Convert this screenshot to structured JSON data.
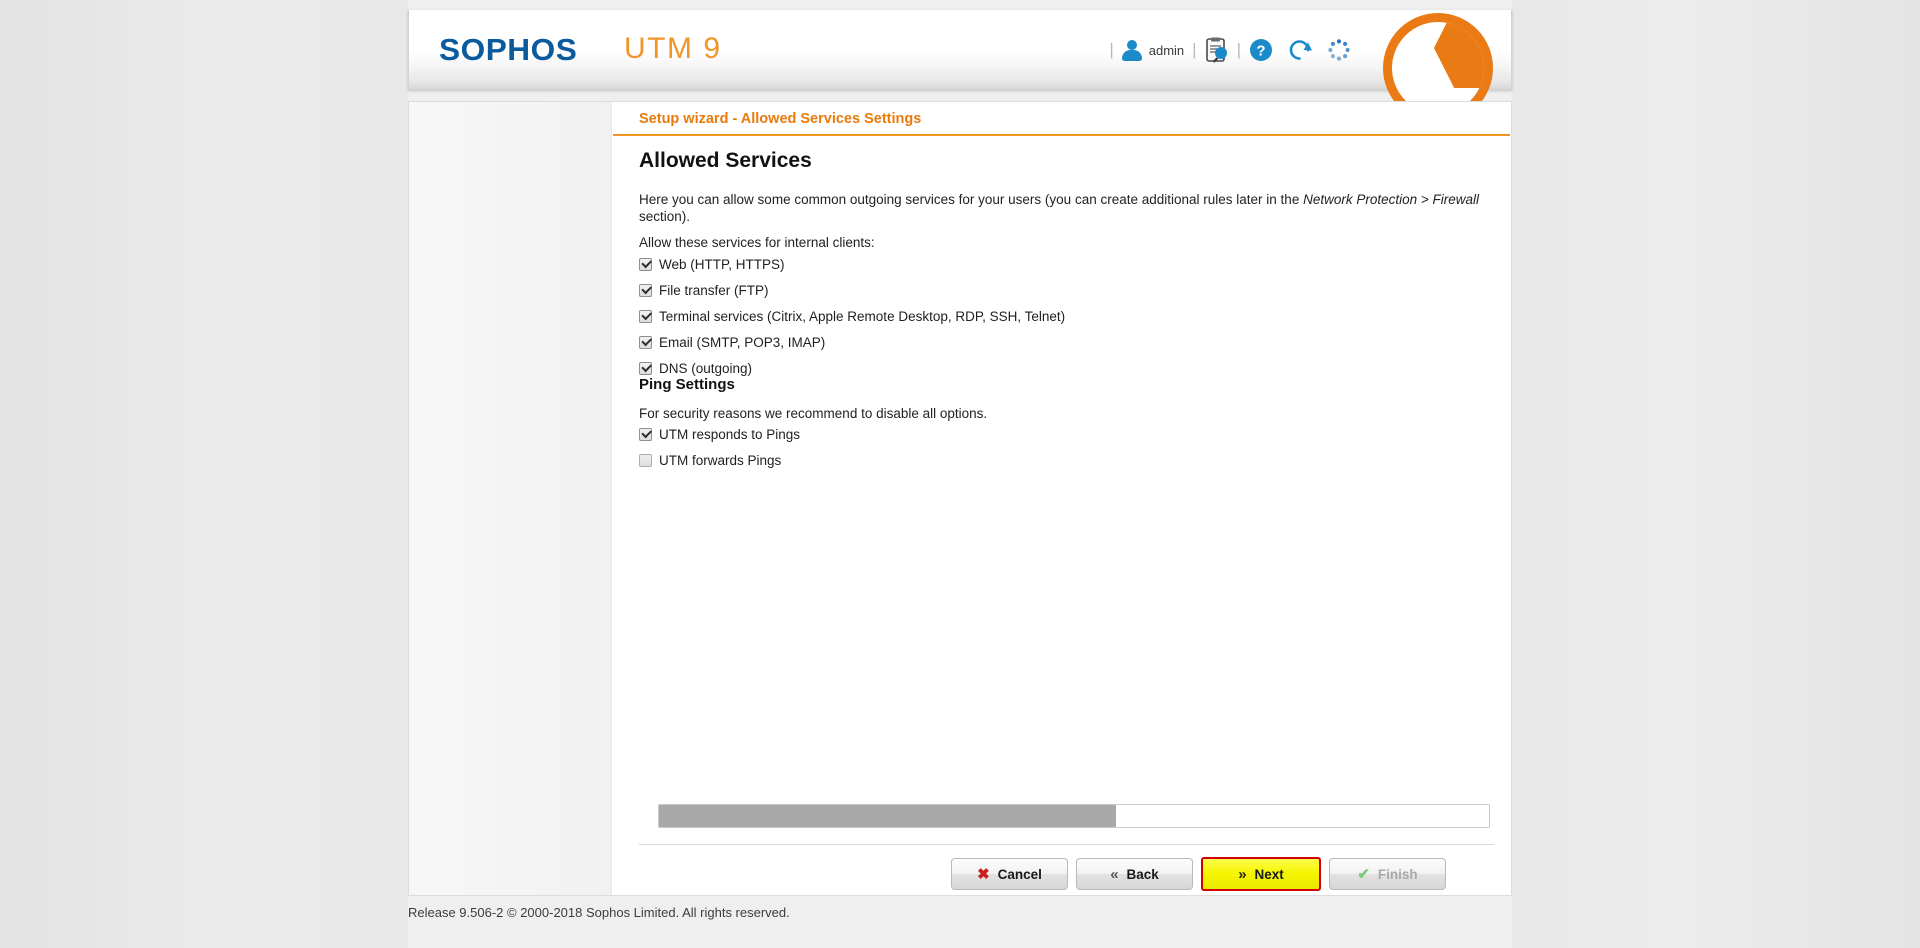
{
  "header": {
    "brand": "SOPHOS",
    "product": "UTM 9",
    "user_label": "admin",
    "separator": "|",
    "icons": [
      {
        "name": "user-icon",
        "title": "admin"
      },
      {
        "name": "clipboard-search-icon",
        "title": "Logs"
      },
      {
        "name": "help-icon",
        "title": "Help"
      },
      {
        "name": "reload-icon",
        "title": "Reload"
      },
      {
        "name": "loading-spinner-icon",
        "title": "Loading"
      }
    ],
    "brand_color": "#0a5a9e",
    "product_color": "#f0952a",
    "logo_color": "#ea7a14"
  },
  "wizard": {
    "breadcrumb_title": "Setup wizard - Allowed Services Settings",
    "breadcrumb_color": "#e87b0b",
    "page_heading": "Allowed Services",
    "intro_part1": "Here you can allow some common outgoing services for your users (you can create additional rules later in the ",
    "intro_italic": "Network Protection > Firewall",
    "intro_part2": " section).",
    "services_label": "Allow these services for internal clients:",
    "services": [
      {
        "label": "Web (HTTP, HTTPS)",
        "checked": true
      },
      {
        "label": "File transfer (FTP)",
        "checked": true
      },
      {
        "label": "Terminal services (Citrix, Apple Remote Desktop, RDP, SSH, Telnet)",
        "checked": true
      },
      {
        "label": "Email (SMTP, POP3, IMAP)",
        "checked": true
      },
      {
        "label": "DNS (outgoing)",
        "checked": true
      }
    ],
    "ping_heading": "Ping Settings",
    "ping_desc": "For security reasons we recommend to disable all options.",
    "ping_options": [
      {
        "label": "UTM responds to Pings",
        "checked": true
      },
      {
        "label": "UTM forwards Pings",
        "checked": false
      }
    ],
    "progress_percent": 55,
    "buttons": {
      "cancel": "Cancel",
      "back": "Back",
      "next": "Next",
      "finish": "Finish",
      "next_highlight_fill": "#f5f500",
      "next_highlight_border": "#d40000"
    }
  },
  "footer": {
    "text": "Release 9.506-2  © 2000-2018 Sophos Limited. All rights reserved."
  }
}
